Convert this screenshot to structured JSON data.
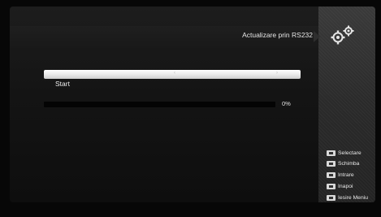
{
  "header": {
    "title": "Actualizare prin RS232"
  },
  "menu": {
    "selected_row": {
      "label": "",
      "value": "",
      "left_arrow": "‹",
      "right_arrow": "›"
    },
    "start_label": "Start"
  },
  "progress": {
    "value_percent": 0,
    "text": "0%"
  },
  "help": [
    {
      "icon": "select-key-icon",
      "label": "Selectare"
    },
    {
      "icon": "change-key-icon",
      "label": "Schimba"
    },
    {
      "icon": "ok-key-icon",
      "label": "Intrare"
    },
    {
      "icon": "menu-key-icon",
      "label": "Inapoi"
    },
    {
      "icon": "exit-key-icon",
      "label": "Iesire Meniu"
    }
  ],
  "icons": {
    "settings": "gears-icon"
  },
  "colors": {
    "background": "#070707",
    "panel": "#1a1a1a",
    "side_panel": "#2f2f2f",
    "highlight": "#f0f0f0",
    "text": "#e6e6e6"
  }
}
